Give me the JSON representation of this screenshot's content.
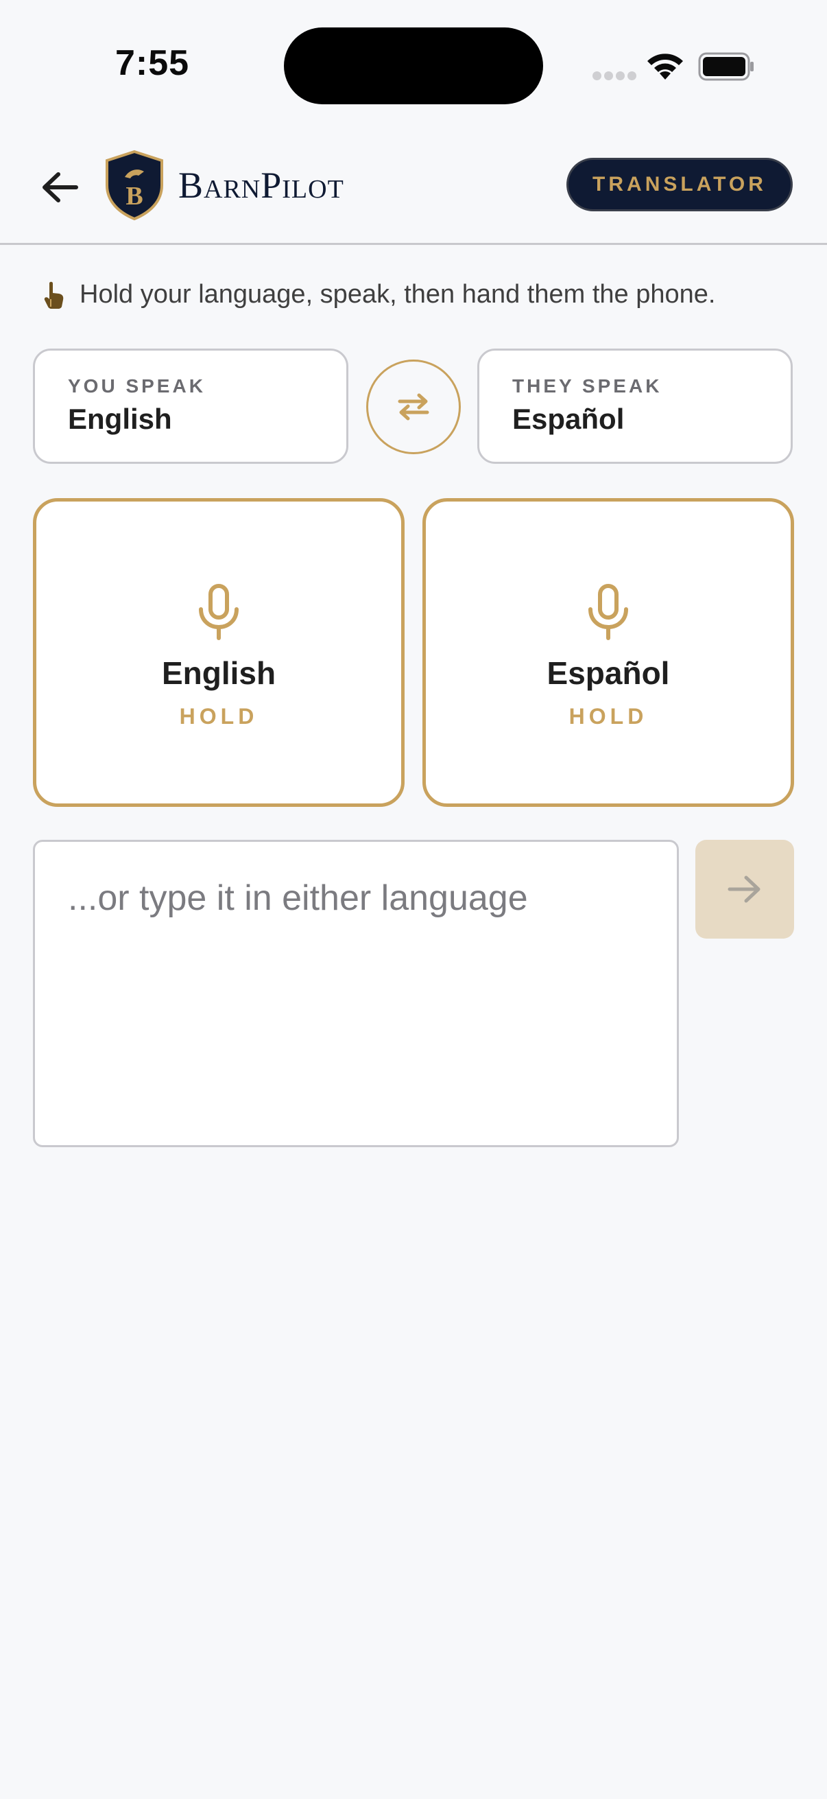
{
  "status_bar": {
    "time": "7:55"
  },
  "header": {
    "brand": "BarnPilot",
    "badge": "TRANSLATOR"
  },
  "hint": {
    "text": "Hold your language, speak, then hand them the phone."
  },
  "languages": {
    "you": {
      "caption": "YOU SPEAK",
      "value": "English"
    },
    "they": {
      "caption": "THEY SPEAK",
      "value": "Español"
    }
  },
  "mic_cards": [
    {
      "language": "English",
      "action": "HOLD"
    },
    {
      "language": "Español",
      "action": "HOLD"
    }
  ],
  "input": {
    "placeholder": "...or type it in either language",
    "value": ""
  },
  "colors": {
    "accent": "#c9a25d",
    "navy": "#0f1a33",
    "send_disabled": "#e7dac4",
    "background": "#f7f8fa"
  },
  "icons": [
    "back-arrow-icon",
    "shield-logo-icon",
    "hand-pointer-icon",
    "swap-arrows-icon",
    "microphone-icon",
    "send-arrow-icon"
  ]
}
